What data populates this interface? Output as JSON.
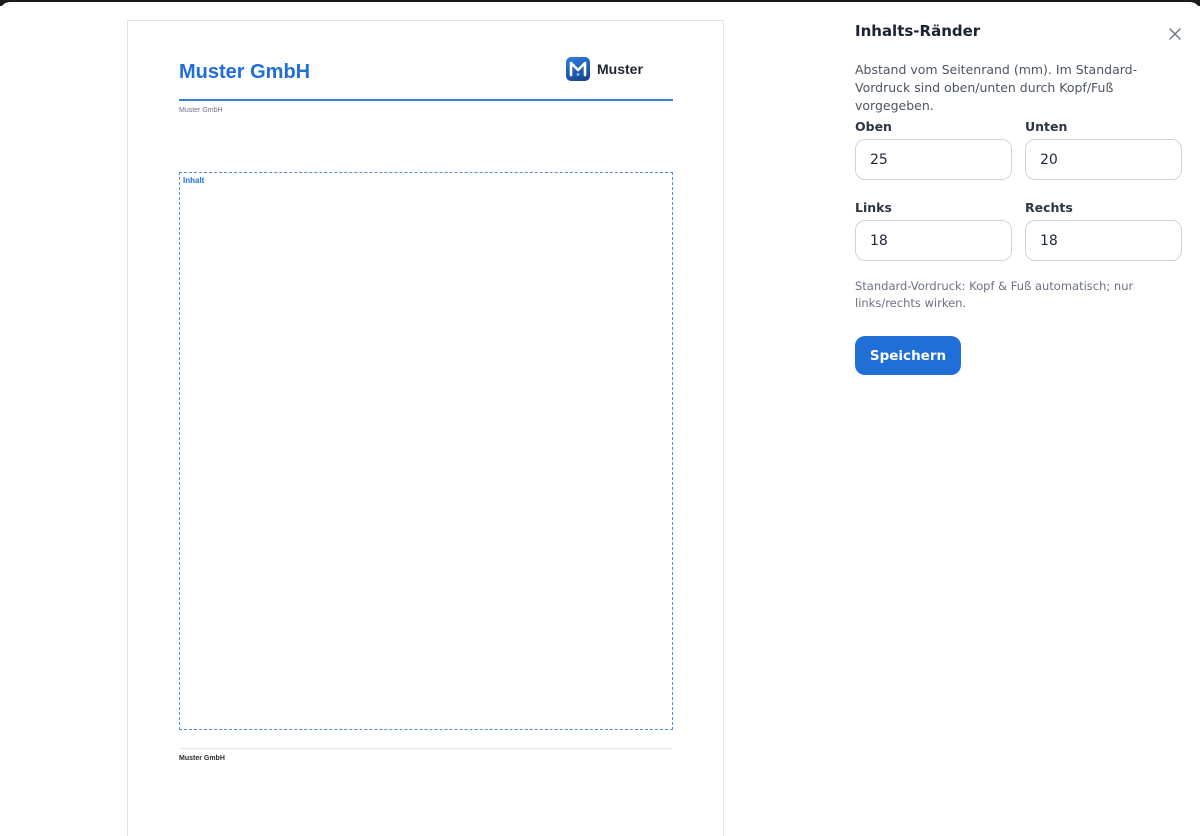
{
  "document": {
    "company_name": "Muster GmbH",
    "logo_letter": "M",
    "logo_text": "Muster",
    "header_subline": "Muster GmbH",
    "content_label": "Inhalt",
    "footer_text": "Muster GmbH"
  },
  "panel": {
    "title": "Inhalts-Ränder",
    "description": "Abstand vom Seitenrand (mm). Im Standard-Vordruck sind oben/unten durch Kopf/Fuß vorgegeben.",
    "fields": {
      "oben": {
        "label": "Oben",
        "value": "25"
      },
      "unten": {
        "label": "Unten",
        "value": "20"
      },
      "links": {
        "label": "Links",
        "value": "18"
      },
      "rechts": {
        "label": "Rechts",
        "value": "18"
      }
    },
    "note": "Standard-Vordruck: Kopf & Fuß automatisch; nur links/rechts wirken.",
    "save_label": "Speichern"
  },
  "colors": {
    "accent": "#1f6fd6",
    "content_border": "#4a8fe0"
  },
  "icons": {
    "close": "close-icon",
    "logo": "muster-logo-icon"
  }
}
